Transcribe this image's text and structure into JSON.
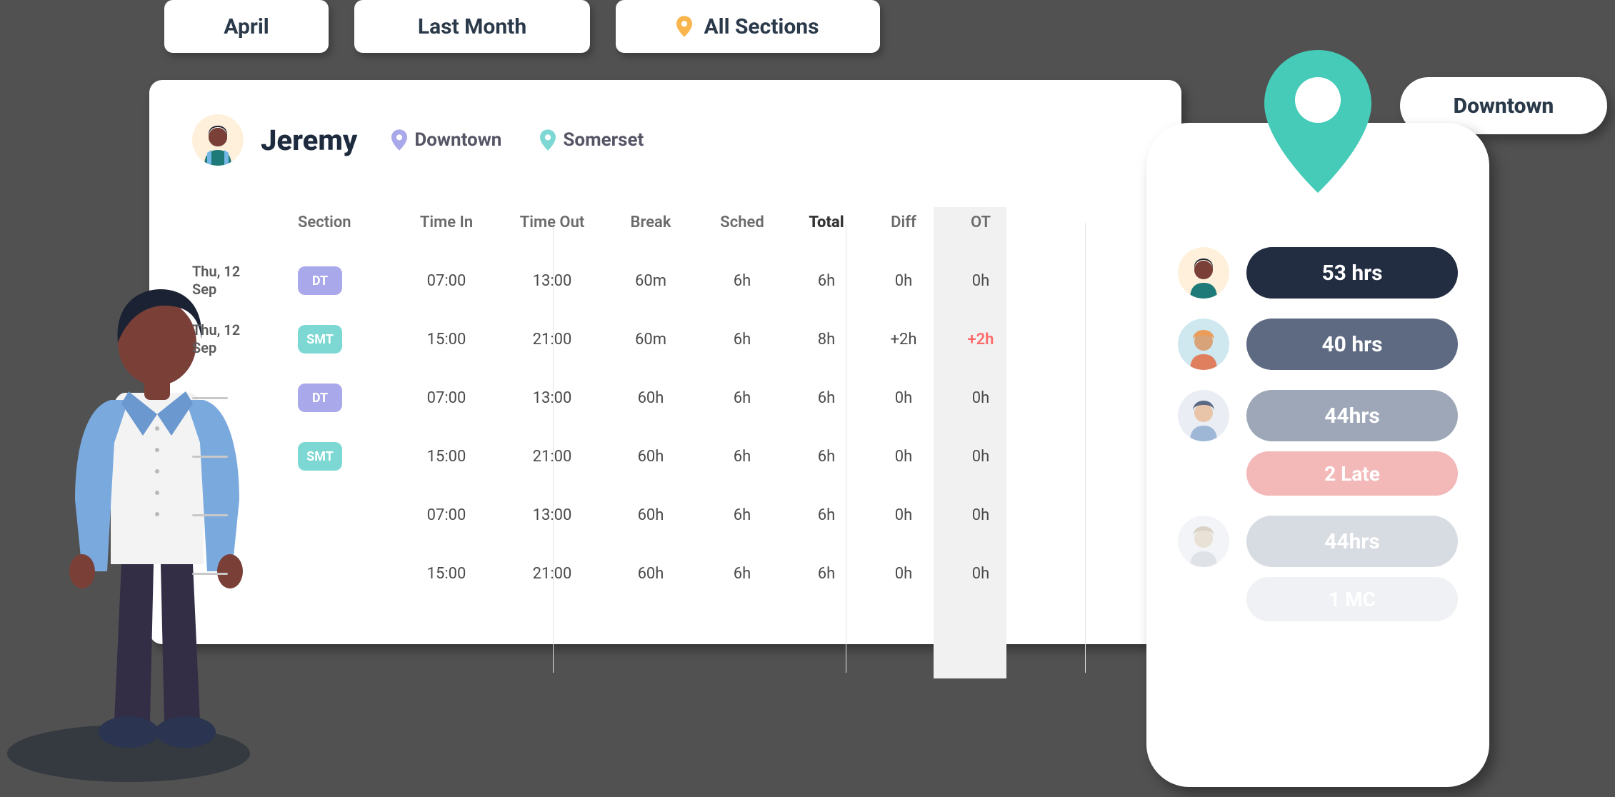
{
  "filters": {
    "month": "April",
    "period": "Last Month",
    "sections": "All Sections"
  },
  "employee": {
    "name": "Jeremy",
    "locations": [
      {
        "label": "Downtown",
        "color": "#a9a8ea"
      },
      {
        "label": "Somerset",
        "color": "#7dd8d3"
      }
    ]
  },
  "columns": {
    "date": "",
    "section": "Section",
    "timeIn": "Time In",
    "timeOut": "Time Out",
    "break": "Break",
    "sched": "Sched",
    "total": "Total",
    "diff": "Diff",
    "ot": "OT"
  },
  "rows": [
    {
      "date": "Thu, 12 Sep",
      "section": "DT",
      "sectionColor": "#a9a8ea",
      "timeIn": "07:00",
      "timeOut": "13:00",
      "break": "60m",
      "sched": "6h",
      "total": "6h",
      "diff": "0h",
      "ot": "0h",
      "otFlag": false
    },
    {
      "date": "Thu, 12 Sep",
      "section": "SMT",
      "sectionColor": "#7dd8d3",
      "timeIn": "15:00",
      "timeOut": "21:00",
      "break": "60m",
      "sched": "6h",
      "total": "8h",
      "diff": "+2h",
      "ot": "+2h",
      "otFlag": true
    },
    {
      "date": "",
      "section": "DT",
      "sectionColor": "#a9a8ea",
      "timeIn": "07:00",
      "timeOut": "13:00",
      "break": "60h",
      "sched": "6h",
      "total": "6h",
      "diff": "0h",
      "ot": "0h",
      "otFlag": false
    },
    {
      "date": "",
      "section": "SMT",
      "sectionColor": "#7dd8d3",
      "timeIn": "15:00",
      "timeOut": "21:00",
      "break": "60h",
      "sched": "6h",
      "total": "6h",
      "diff": "0h",
      "ot": "0h",
      "otFlag": false
    },
    {
      "date": "",
      "section": "",
      "sectionColor": "",
      "timeIn": "07:00",
      "timeOut": "13:00",
      "break": "60h",
      "sched": "6h",
      "total": "6h",
      "diff": "0h",
      "ot": "0h",
      "otFlag": false
    },
    {
      "date": "",
      "section": "",
      "sectionColor": "",
      "timeIn": "15:00",
      "timeOut": "21:00",
      "break": "60h",
      "sched": "6h",
      "total": "6h",
      "diff": "0h",
      "ot": "0h",
      "otFlag": false
    }
  ],
  "phone": {
    "location": "Downtown",
    "staff": [
      {
        "hours": "53 hrs",
        "pillColor": "#222d42",
        "avatarBg": "#fff0db",
        "sub": null,
        "subColor": null
      },
      {
        "hours": "40 hrs",
        "pillColor": "#5d6a82",
        "avatarBg": "#cfe8f0",
        "sub": null,
        "subColor": null
      },
      {
        "hours": "44hrs",
        "pillColor": "#9ea7b8",
        "avatarBg": "#eaeef4",
        "sub": "2 Late",
        "subColor": "#f3b8b8"
      },
      {
        "hours": "44hrs",
        "pillColor": "#d7dbe2",
        "avatarBg": "#f2f4f7",
        "sub": "1 MC",
        "subColor": "#eff1f4"
      }
    ]
  },
  "callout": "Downtown"
}
